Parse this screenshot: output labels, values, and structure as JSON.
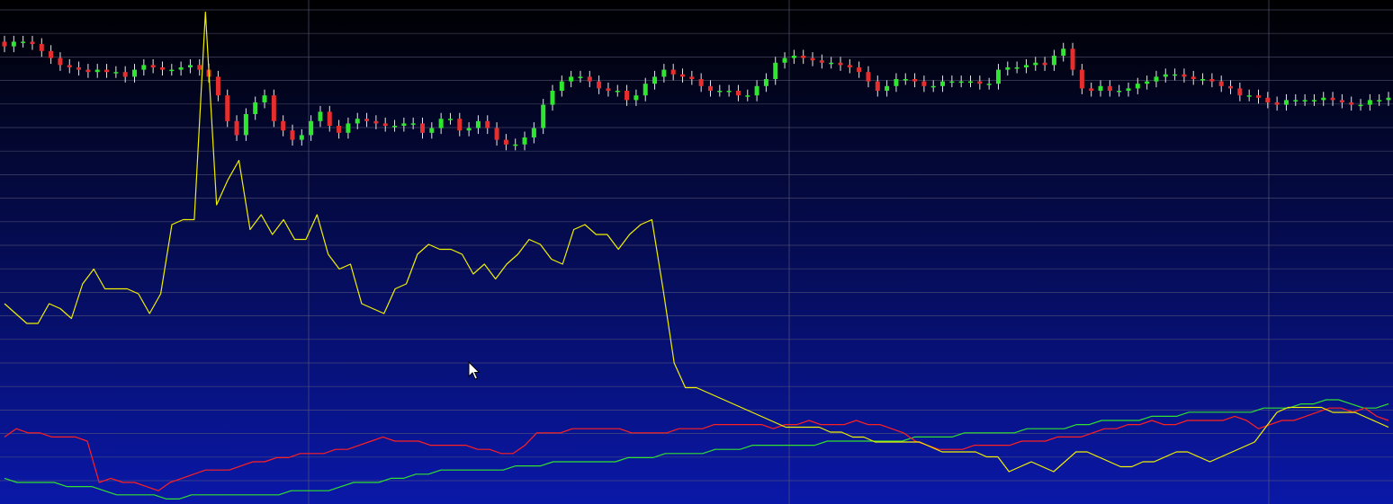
{
  "chart_data": {
    "type": "line",
    "title": "",
    "xlabel": "",
    "ylabel": "",
    "grid": true,
    "legend": "none",
    "colors": {
      "background_top": "#000000",
      "background_bottom": "#0a18a8",
      "grid": "#5a5a78",
      "up_candle": "#2ee62e",
      "down_candle": "#e62e2e",
      "wick": "#e8e8e8",
      "yellow_line": "#f0f000",
      "red_line": "#ff2020",
      "green_line": "#30e030"
    },
    "x_count": 150,
    "candles": {
      "ylim": [
        0,
        100
      ],
      "close": [
        84,
        86,
        86,
        85,
        82,
        79,
        76,
        75,
        74,
        73,
        74,
        73,
        73,
        71,
        74,
        76,
        75,
        74,
        74,
        75,
        76,
        74,
        71,
        63,
        52,
        46,
        55,
        60,
        63,
        52,
        48,
        44,
        46,
        52,
        56,
        50,
        47,
        51,
        53,
        52,
        51,
        50,
        50,
        51,
        51,
        47,
        49,
        53,
        53,
        48,
        49,
        52,
        49,
        44,
        42,
        42,
        45,
        49,
        59,
        65,
        69,
        71,
        71,
        69,
        66,
        65,
        65,
        61,
        63,
        68,
        71,
        74,
        72,
        71,
        70,
        67,
        65,
        65,
        65,
        63,
        63,
        67,
        70,
        77,
        79,
        80,
        79,
        78,
        77,
        77,
        76,
        75,
        73,
        69,
        65,
        67,
        70,
        70,
        69,
        67,
        67,
        69,
        69,
        69,
        69,
        68,
        68,
        74,
        75,
        75,
        76,
        77,
        76,
        80,
        83,
        74,
        66,
        65,
        67,
        65,
        65,
        66,
        68,
        69,
        71,
        72,
        72,
        71,
        70,
        70,
        69,
        67,
        66,
        63,
        63,
        62,
        60,
        59,
        61,
        61,
        61,
        61,
        62,
        61,
        60,
        59,
        59,
        61,
        61,
        62
      ]
    },
    "yellow_series": {
      "ylim": [
        0,
        100
      ],
      "values": [
        40,
        38,
        36,
        36,
        40,
        39,
        37,
        44,
        47,
        43,
        43,
        43,
        42,
        38,
        42,
        56,
        57,
        57,
        99,
        60,
        65,
        69,
        55,
        58,
        54,
        57,
        53,
        53,
        58,
        50,
        47,
        48,
        40,
        39,
        38,
        43,
        44,
        50,
        52,
        51,
        51,
        50,
        46,
        48,
        45,
        48,
        50,
        53,
        52,
        49,
        48,
        55,
        56,
        54,
        54,
        51,
        54,
        56,
        57,
        43,
        28,
        23,
        23,
        22,
        21,
        20,
        19,
        18,
        17,
        16,
        15,
        15,
        15,
        15,
        14,
        14,
        13,
        13,
        12,
        12,
        12,
        12,
        12,
        11,
        10,
        10,
        10,
        10,
        9,
        9,
        6,
        7,
        8,
        7,
        6,
        8,
        10,
        10,
        9,
        8,
        7,
        7,
        8,
        8,
        9,
        10,
        10,
        9,
        8,
        9,
        10,
        11,
        12,
        15,
        18,
        19,
        19,
        19,
        19,
        18,
        18,
        18,
        17,
        16,
        15
      ]
    },
    "red_series": {
      "ylim": [
        0,
        100
      ],
      "values": [
        16,
        18,
        17,
        17,
        16,
        16,
        16,
        15,
        5,
        6,
        5,
        5,
        4,
        3,
        5,
        6,
        7,
        8,
        8,
        8,
        9,
        10,
        10,
        11,
        11,
        12,
        12,
        12,
        13,
        13,
        14,
        15,
        16,
        15,
        15,
        15,
        14,
        14,
        14,
        14,
        13,
        13,
        12,
        12,
        14,
        17,
        17,
        17,
        18,
        18,
        18,
        18,
        18,
        17,
        17,
        17,
        17,
        18,
        18,
        18,
        19,
        19,
        19,
        19,
        19,
        18,
        19,
        19,
        20,
        19,
        19,
        19,
        20,
        19,
        19,
        18,
        17,
        15,
        14,
        13,
        13,
        13,
        14,
        14,
        14,
        14,
        15,
        15,
        15,
        16,
        16,
        16,
        17,
        18,
        18,
        19,
        19,
        20,
        19,
        19,
        20,
        20,
        20,
        20,
        21,
        20,
        18,
        19,
        20,
        20,
        21,
        22,
        23,
        23,
        22,
        23,
        21,
        20
      ]
    },
    "green_series": {
      "ylim": [
        0,
        100
      ],
      "values": [
        6,
        5,
        5,
        5,
        5,
        4,
        4,
        4,
        3,
        2,
        2,
        2,
        2,
        1,
        1,
        2,
        2,
        2,
        2,
        2,
        2,
        2,
        2,
        3,
        3,
        3,
        3,
        4,
        5,
        5,
        5,
        6,
        6,
        7,
        7,
        8,
        8,
        8,
        8,
        8,
        8,
        9,
        9,
        9,
        10,
        10,
        10,
        10,
        10,
        10,
        11,
        11,
        11,
        12,
        12,
        12,
        12,
        13,
        13,
        13,
        14,
        14,
        14,
        14,
        14,
        14,
        15,
        15,
        15,
        15,
        15,
        15,
        15,
        16,
        16,
        16,
        16,
        17,
        17,
        17,
        17,
        17,
        18,
        18,
        18,
        18,
        19,
        19,
        20,
        20,
        20,
        20,
        21,
        21,
        21,
        22,
        22,
        22,
        22,
        22,
        22,
        23,
        23,
        23,
        24,
        24,
        25,
        25,
        24,
        23,
        23,
        24
      ]
    }
  }
}
